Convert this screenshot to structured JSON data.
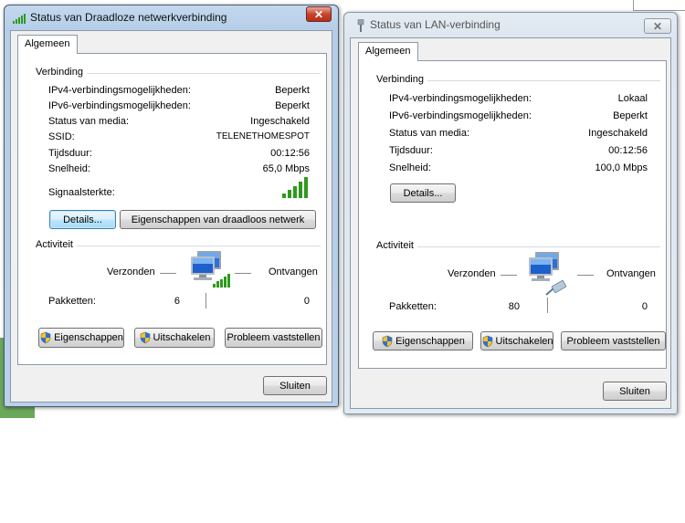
{
  "wireless": {
    "title": "Status van Draadloze netwerkverbinding",
    "close_glyph": "✕",
    "tab": "Algemeen",
    "connection_group": "Verbinding",
    "rows": [
      {
        "label": "IPv4-verbindingsmogelijkheden:",
        "value": "Beperkt"
      },
      {
        "label": "IPv6-verbindingsmogelijkheden:",
        "value": "Beperkt"
      },
      {
        "label": "Status van media:",
        "value": "Ingeschakeld"
      },
      {
        "label": "SSID:",
        "value": "TELENETHOMESPOT"
      },
      {
        "label": "Tijdsduur:",
        "value": "00:12:56"
      },
      {
        "label": "Snelheid:",
        "value": "65,0 Mbps"
      }
    ],
    "signal_label": "Signaalsterkte:",
    "signal_bars": 5,
    "details_button": "Details...",
    "wireless_props_button": "Eigenschappen van draadloos netwerk",
    "activity_group": "Activiteit",
    "sent_label": "Verzonden",
    "received_label": "Ontvangen",
    "packets_label": "Pakketten:",
    "packets_sent": "6",
    "packets_received": "0",
    "properties_button": "Eigenschappen",
    "disable_button": "Uitschakelen",
    "diagnose_button": "Probleem vaststellen",
    "close_button": "Sluiten"
  },
  "lan": {
    "title": "Status van LAN-verbinding",
    "close_glyph": "✕",
    "tab": "Algemeen",
    "connection_group": "Verbinding",
    "rows": [
      {
        "label": "IPv4-verbindingsmogelijkheden:",
        "value": "Lokaal"
      },
      {
        "label": "IPv6-verbindingsmogelijkheden:",
        "value": "Beperkt"
      },
      {
        "label": "Status van media:",
        "value": "Ingeschakeld"
      },
      {
        "label": "Tijdsduur:",
        "value": "00:12:56"
      },
      {
        "label": "Snelheid:",
        "value": "100,0 Mbps"
      }
    ],
    "details_button": "Details...",
    "activity_group": "Activiteit",
    "sent_label": "Verzonden",
    "received_label": "Ontvangen",
    "packets_label": "Pakketten:",
    "packets_sent": "80",
    "packets_received": "0",
    "properties_button": "Eigenschappen",
    "disable_button": "Uitschakelen",
    "diagnose_button": "Probleem vaststellen",
    "close_button": "Sluiten"
  },
  "colors": {
    "signal_green": "#2e9a1c",
    "close_red": "#c8442c",
    "focus_blue": "#3c7fb1"
  },
  "icons": {
    "wireless_title": "wireless-signal-icon",
    "lan_title": "network-plug-icon",
    "computer": "computer-icon",
    "shield": "uac-shield-icon"
  }
}
